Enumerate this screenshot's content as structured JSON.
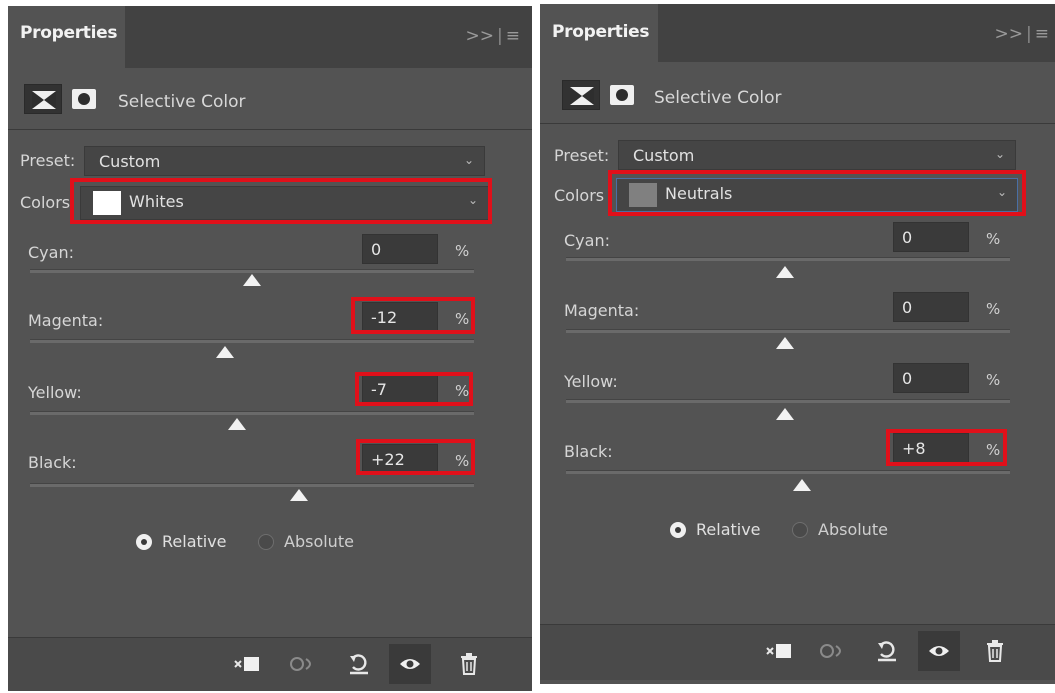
{
  "panels": [
    {
      "tab_title": "Properties",
      "tab_menu": ">>",
      "adjustment_title": "Selective Color",
      "preset_label": "Preset:",
      "preset_value": "Custom",
      "colors_label": "Colors",
      "colors_value": "Whites",
      "swatch_color": "#ffffff",
      "sliders": [
        {
          "label": "Cyan:",
          "value": "0",
          "unit": "%"
        },
        {
          "label": "Magenta:",
          "value": "-12",
          "unit": "%"
        },
        {
          "label": "Yellow:",
          "value": "-7",
          "unit": "%"
        },
        {
          "label": "Black:",
          "value": "+22",
          "unit": "%"
        }
      ],
      "method_relative": "Relative",
      "method_absolute": "Absolute",
      "method_selected": "Relative"
    },
    {
      "tab_title": "Properties",
      "tab_menu": ">>",
      "adjustment_title": "Selective Color",
      "preset_label": "Preset:",
      "preset_value": "Custom",
      "colors_label": "Colors",
      "colors_value": "Neutrals",
      "swatch_color": "#808080",
      "sliders": [
        {
          "label": "Cyan:",
          "value": "0",
          "unit": "%"
        },
        {
          "label": "Magenta:",
          "value": "0",
          "unit": "%"
        },
        {
          "label": "Yellow:",
          "value": "0",
          "unit": "%"
        },
        {
          "label": "Black:",
          "value": "+8",
          "unit": "%"
        }
      ],
      "method_relative": "Relative",
      "method_absolute": "Absolute",
      "method_selected": "Relative"
    }
  ],
  "colors": {
    "panel_bg": "#535353",
    "highlight": "#e0101a"
  }
}
